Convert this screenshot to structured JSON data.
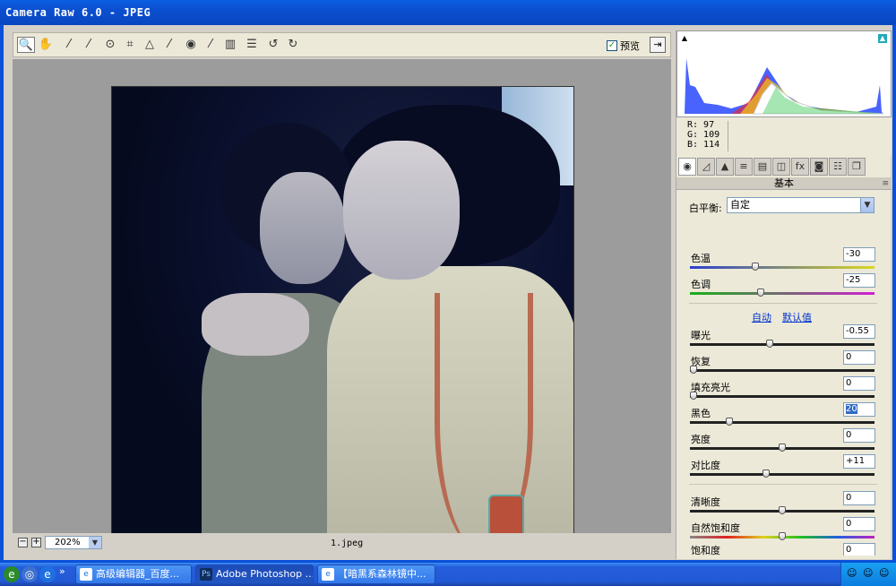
{
  "window": {
    "title": "Camera Raw 6.0 -  JPEG"
  },
  "toolbar": {
    "tools": [
      {
        "name": "zoom-tool",
        "glyph": "🔍"
      },
      {
        "name": "hand-tool",
        "glyph": "✋"
      },
      {
        "name": "white-balance-tool",
        "glyph": "⁄"
      },
      {
        "name": "color-sampler-tool",
        "glyph": "⁄"
      },
      {
        "name": "target-adjust-tool",
        "glyph": "⊙"
      },
      {
        "name": "crop-tool",
        "glyph": "⌗"
      },
      {
        "name": "straighten-tool",
        "glyph": "△"
      },
      {
        "name": "spot-removal-tool",
        "glyph": "⁄"
      },
      {
        "name": "red-eye-tool",
        "glyph": "◉"
      },
      {
        "name": "adjustment-brush-tool",
        "glyph": "⁄"
      },
      {
        "name": "graduated-filter-tool",
        "glyph": "▥"
      },
      {
        "name": "preferences-tool",
        "glyph": "☰"
      },
      {
        "name": "rotate-left-tool",
        "glyph": "↺"
      },
      {
        "name": "rotate-right-tool",
        "glyph": "↻"
      }
    ],
    "preview_label": "预览",
    "preview_checked": "✓",
    "fullscreen_glyph": "⇥"
  },
  "bottom": {
    "zoom_minus": "−",
    "zoom_plus": "+",
    "zoom_value": "202%",
    "zoom_arrow": "▼",
    "filename": "1.jpeg"
  },
  "rgb": {
    "r": "R:   97",
    "g": "G:  109",
    "b": "B:  114"
  },
  "panel_tabs": [
    "◉",
    "◿",
    "▲",
    "≡",
    "▤",
    "◫",
    "fx",
    "◙",
    "☷",
    "❐"
  ],
  "panel": {
    "section_title": "基本",
    "menu_glyph": "≡",
    "white_balance_label": "白平衡:",
    "white_balance_value": "自定",
    "select_arrow": "▼",
    "auto_link": "自动",
    "default_link": "默认值",
    "sliders": {
      "temperature": {
        "label": "色温",
        "value": "-30",
        "fraction": 0.35
      },
      "tint": {
        "label": "色调",
        "value": "-25",
        "fraction": 0.38
      },
      "exposure": {
        "label": "曝光",
        "value": "-0.55",
        "fraction": 0.43
      },
      "recovery": {
        "label": "恢复",
        "value": "0",
        "fraction": 0.0
      },
      "fill_light": {
        "label": "填充亮光",
        "value": "0",
        "fraction": 0.0
      },
      "blacks": {
        "label": "黑色",
        "value": "20",
        "fraction": 0.2
      },
      "brightness": {
        "label": "亮度",
        "value": "0",
        "fraction": 0.5
      },
      "contrast": {
        "label": "对比度",
        "value": "+11",
        "fraction": 0.41
      },
      "clarity": {
        "label": "清晰度",
        "value": "0",
        "fraction": 0.5
      },
      "vibrance": {
        "label": "自然饱和度",
        "value": "0",
        "fraction": 0.5
      },
      "saturation": {
        "label": "饱和度",
        "value": "0",
        "fraction": 0.5
      }
    }
  },
  "taskbar": {
    "tasks": [
      {
        "label": "高级编辑器_百度...",
        "icon": "e",
        "icon_color": "#1E6FE0"
      },
      {
        "label": "Adobe Photoshop ...",
        "icon": "Ps",
        "icon_color": "#0F2D5E"
      },
      {
        "label": "【暗黑系森林镜中...",
        "icon": "e",
        "icon_color": "#1E6FE0"
      }
    ],
    "quicklaunch": [
      "e",
      "◎",
      "e"
    ],
    "chevron": "»",
    "tray_icons": [
      "☺",
      "☺",
      "☺"
    ]
  },
  "colors": {
    "titlebar": "#0B4FD0",
    "panel_bg": "#ECE9D8",
    "canvas_bg": "#9C9C9C",
    "accent_link": "#0033CC"
  }
}
